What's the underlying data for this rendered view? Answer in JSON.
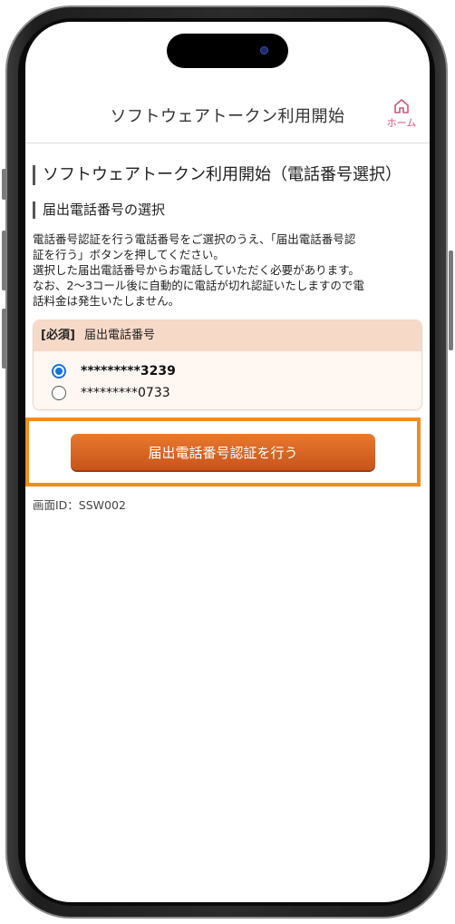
{
  "header": {
    "title": "ソフトウェアトークン利用開始",
    "home_label": "ホーム"
  },
  "main": {
    "section_title": "ソフトウェアトークン利用開始（電話番号選択）",
    "sub_title": "届出電話番号の選択",
    "description_lines": [
      "電話番号認証を行う電話番号をご選択のうえ、「届出電話番号認",
      "証を行う」ボタンを押してください。",
      "選択した届出電話番号からお電話していただく必要があります。",
      "なお、2〜3コール後に自動的に電話が切れ認証いたしますので電",
      "話料金は発生いたしません。"
    ],
    "panel": {
      "required_tag": "[必須]",
      "label": "届出電話番号",
      "options": [
        {
          "label": "*********3239",
          "selected": true
        },
        {
          "label": "*********0733",
          "selected": false
        }
      ]
    },
    "submit_label": "届出電話番号認証を行う",
    "screen_id": "画面ID：SSW002"
  },
  "colors": {
    "accent_pink": "#d1557a",
    "button_orange": "#d8622a",
    "highlight_orange": "#f28c1a",
    "panel_header": "#f7d9c8",
    "radio_blue": "#1a6fe0"
  }
}
